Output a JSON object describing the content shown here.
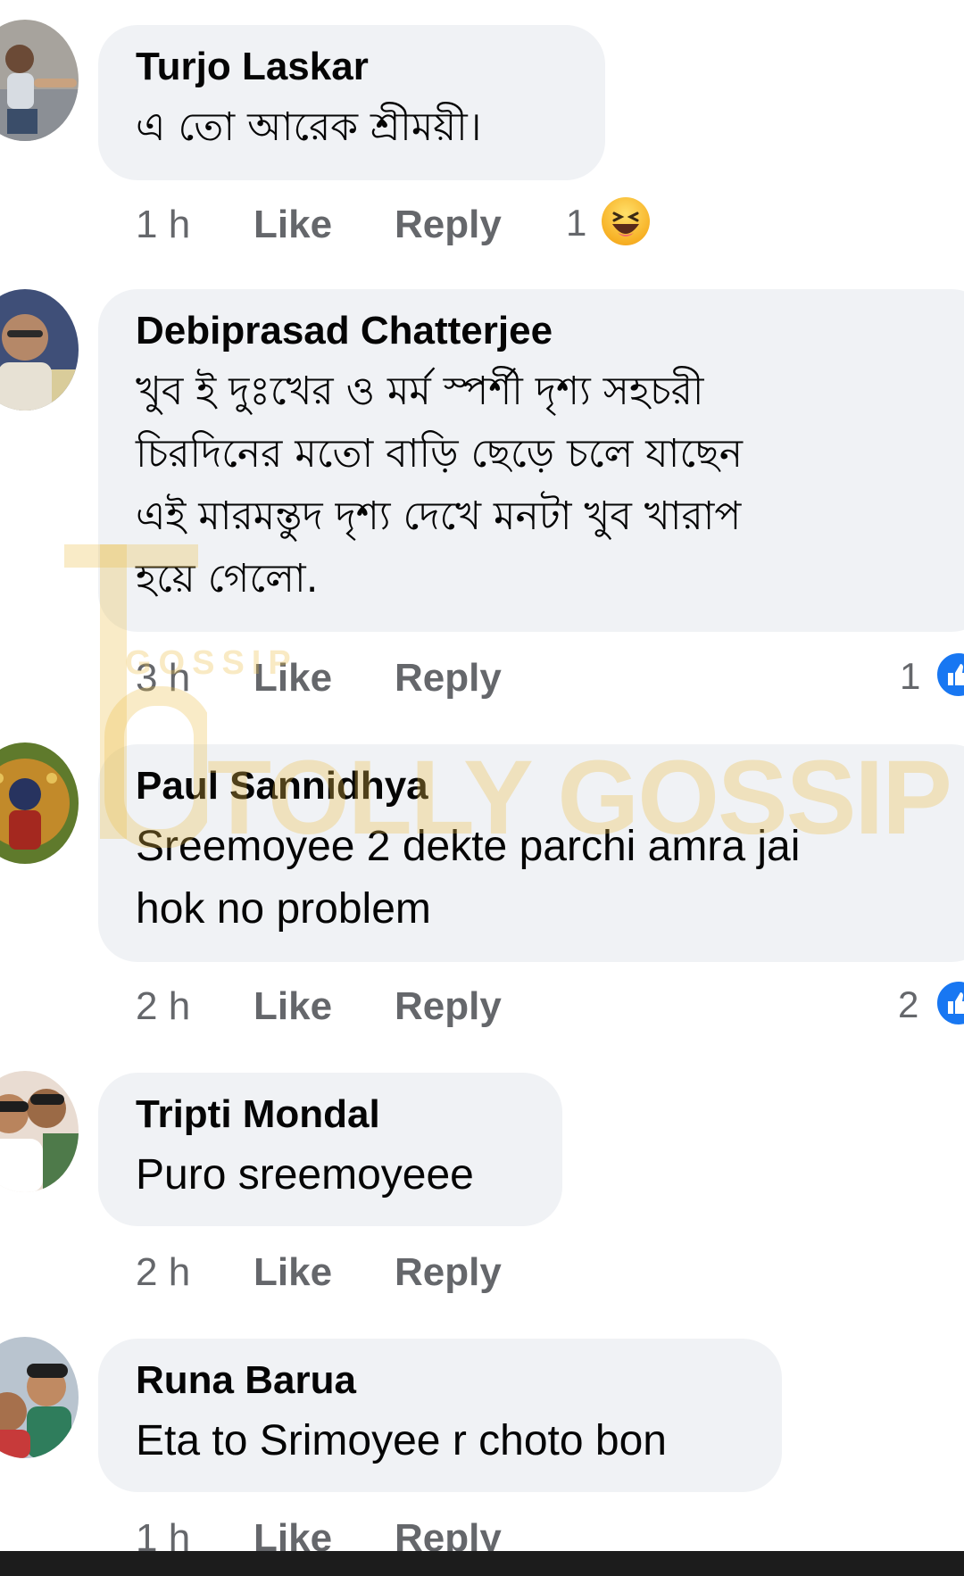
{
  "comments": [
    {
      "author": "Turjo Laskar",
      "text_lines": [
        "এ তো আরেক শ্রীময়ী।"
      ],
      "time": "1 h",
      "like": "Like",
      "reply": "Reply",
      "reaction_count": "1",
      "reaction_icon": "haha-emoji-icon"
    },
    {
      "author": "Debiprasad Chatterjee",
      "text_lines": [
        "খুব ই দুঃখের ও মর্ম স্পর্শী দৃশ্য সহচরী",
        "চিরদিনের মতো বাড়ি ছেড়ে চলে যাছেন",
        "এই মারমন্তুদ দৃশ্য দেখে মনটা খুব খারাপ",
        "হয়ে গেলো."
      ],
      "time": "3 h",
      "like": "Like",
      "reply": "Reply",
      "reaction_count": "1",
      "reaction_icon": "like-reaction-icon"
    },
    {
      "author": "Paul Sannidhya",
      "text_lines": [
        "Sreemoyee 2 dekte parchi amra jai",
        "hok no problem"
      ],
      "time": "2 h",
      "like": "Like",
      "reply": "Reply",
      "reaction_count": "2",
      "reaction_icon": "like-reaction-icon"
    },
    {
      "author": "Tripti Mondal",
      "text_lines": [
        "Puro sreemoyeee"
      ],
      "time": "2 h",
      "like": "Like",
      "reply": "Reply"
    },
    {
      "author": "Runa Barua",
      "text_lines": [
        "Eta to Srimoyee r choto bon"
      ],
      "time": "1 h",
      "like": "Like",
      "reply": "Reply"
    }
  ],
  "watermark": {
    "brand": "TOLLY GOSSIP",
    "small": "GOSSIP"
  },
  "colors": {
    "bubble": "#f0f2f5",
    "meta_text": "#65676b",
    "like_blue": "#1877f2"
  }
}
